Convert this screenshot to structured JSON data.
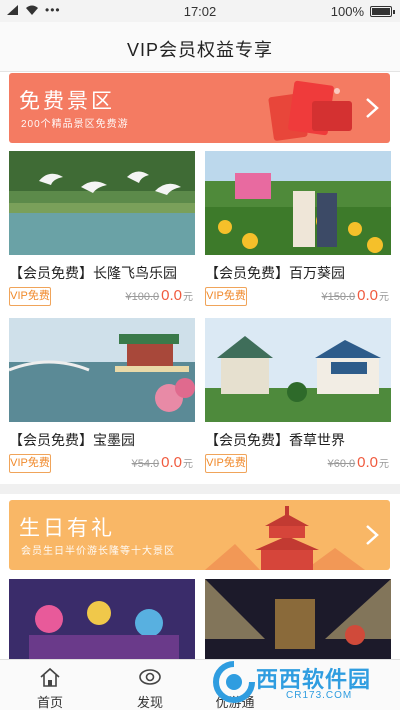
{
  "status_bar": {
    "time": "17:02",
    "battery": "100%"
  },
  "header": {
    "title": "VIP会员权益专享"
  },
  "banner_free": {
    "title": "免费景区",
    "subtitle": "200个精品景区免费游"
  },
  "banner_birthday": {
    "title": "生日有礼",
    "subtitle": "会员生日半价游长隆等十大景区"
  },
  "cards": [
    {
      "name": "【会员免费】长隆飞鸟乐园",
      "tag": "VIP免费",
      "old_price": "¥100.0",
      "new_price": "0.0",
      "unit": "元"
    },
    {
      "name": "【会员免费】百万葵园",
      "tag": "VIP免费",
      "old_price": "¥150.0",
      "new_price": "0.0",
      "unit": "元"
    },
    {
      "name": "【会员免费】宝墨园",
      "tag": "VIP免费",
      "old_price": "¥54.0",
      "new_price": "0.0",
      "unit": "元"
    },
    {
      "name": "【会员免费】香草世界",
      "tag": "VIP免费",
      "old_price": "¥60.0",
      "new_price": "0.0",
      "unit": "元"
    }
  ],
  "tabbar": {
    "home": "首页",
    "discover": "发现",
    "tour": "优游通"
  },
  "watermark": {
    "text": "西西软件园",
    "url": "CR173.COM"
  },
  "colors": {
    "banner_free": "#f47b62",
    "banner_birthday": "#f9b766",
    "price": "#f05a3e",
    "vip_tag": "#f08a2c"
  },
  "icons": {
    "home": "home-icon",
    "discover": "eye-icon",
    "arrow": "chevron-right-icon"
  }
}
